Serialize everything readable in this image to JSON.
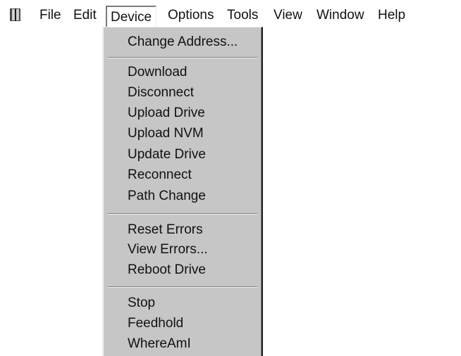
{
  "menubar": {
    "app_icon": "book-icon",
    "items": [
      {
        "label": "File"
      },
      {
        "label": "Edit"
      },
      {
        "label": "Device"
      },
      {
        "label": "Options"
      },
      {
        "label": "Tools"
      },
      {
        "label": "View"
      },
      {
        "label": "Window"
      },
      {
        "label": "Help"
      }
    ],
    "open_menu": "Device"
  },
  "device_menu": {
    "groups": [
      [
        "Change Address..."
      ],
      [
        "Download",
        "Disconnect",
        "Upload Drive",
        "Upload NVM",
        "Update Drive",
        "Reconnect",
        "Path Change"
      ],
      [
        "Reset Errors",
        "View Errors...",
        "Reboot Drive"
      ],
      [
        "Stop",
        "Feedhold",
        "WhereAmI"
      ]
    ]
  },
  "colors": {
    "menu_background": "#c6c6c6",
    "menubar_background": "#ffffff",
    "text": "#111111"
  }
}
